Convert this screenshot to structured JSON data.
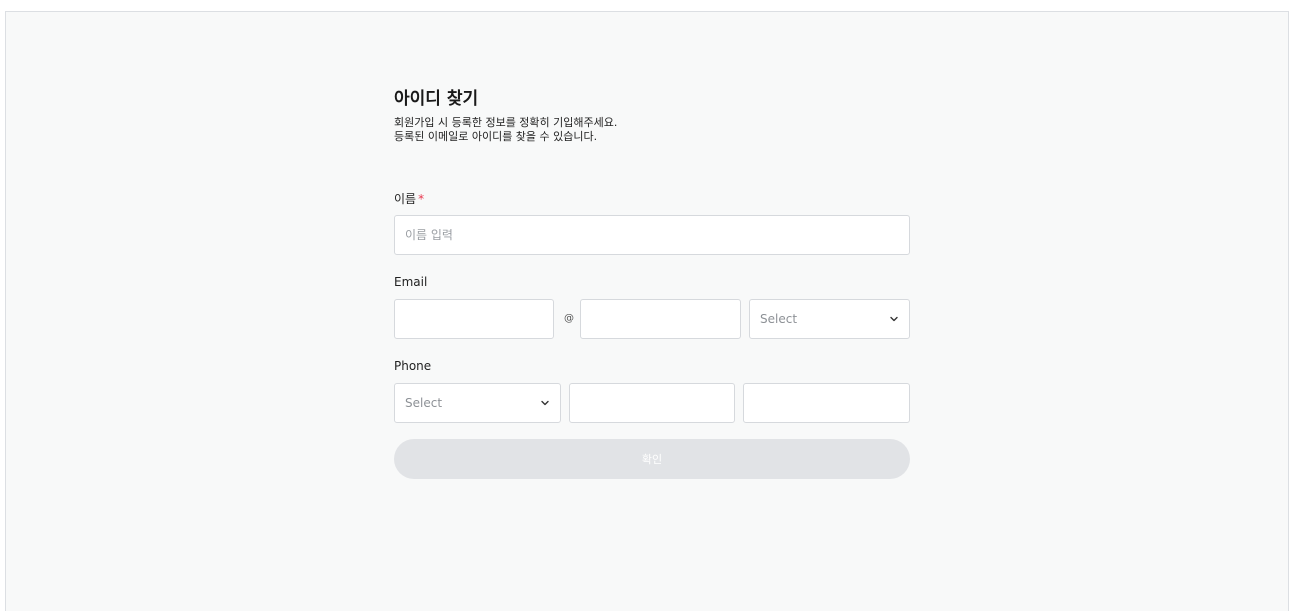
{
  "page": {
    "title": "아이디 찾기",
    "description_lines": [
      "회원가입 시 등록한 정보를 정확히 기입해주세요.",
      "등록된 이메일로 아이디를 찾을 수 있습니다."
    ]
  },
  "name_field": {
    "label": "이름",
    "required_mark": "*",
    "placeholder": "이름 입력",
    "value": ""
  },
  "email_field": {
    "label": "Email",
    "local_value": "",
    "at_symbol": "@",
    "domain_value": "",
    "domain_select_value": "Select"
  },
  "phone_field": {
    "label": "Phone",
    "prefix_select_value": "Select",
    "middle_value": "",
    "last_value": ""
  },
  "confirm_button": {
    "label": "확인"
  },
  "colors": {
    "background": "#f8f9f9",
    "required": "#e8384f",
    "button_disabled": "#e1e3e6"
  },
  "icons": {
    "select_arrow": "chevron-down-icon"
  }
}
